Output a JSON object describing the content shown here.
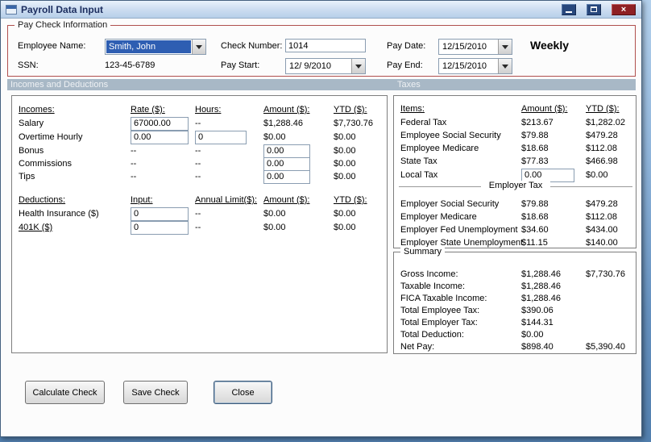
{
  "window": {
    "title": "Payroll Data Input"
  },
  "icons": {
    "close": "×"
  },
  "paycheck": {
    "group_title": "Pay Check Information",
    "labels": {
      "employee": "Employee Name:",
      "ssn": "SSN:",
      "check_number": "Check Number:",
      "pay_start": "Pay Start:",
      "pay_date": "Pay Date:",
      "pay_end": "Pay End:"
    },
    "employee_name": "Smith, John",
    "ssn": "123-45-6789",
    "check_number": "1014",
    "pay_start": "12/ 9/2010",
    "pay_date": "12/15/2010",
    "pay_end": "12/15/2010",
    "frequency": "Weekly"
  },
  "bands": {
    "left": "Incomes and Deductions",
    "right": "Taxes"
  },
  "incomes": {
    "headers": {
      "col1": "Incomes:",
      "col2": "Rate ($):",
      "col3": "Hours:",
      "col4": "Amount ($):",
      "col5": "YTD ($):"
    },
    "salary": {
      "label": "Salary",
      "rate": "67000.00",
      "hours": "--",
      "amount": "$1,288.46",
      "ytd": "$7,730.76"
    },
    "overtime": {
      "label": "Overtime Hourly",
      "rate": "0.00",
      "hours": "0",
      "amount": "$0.00",
      "ytd": "$0.00"
    },
    "bonus": {
      "label": "Bonus",
      "rate": "--",
      "hours": "--",
      "amount": "0.00",
      "ytd": "$0.00"
    },
    "commissions": {
      "label": "Commissions",
      "rate": "--",
      "hours": "--",
      "amount": "0.00",
      "ytd": "$0.00"
    },
    "tips": {
      "label": "Tips",
      "rate": "--",
      "hours": "--",
      "amount": "0.00",
      "ytd": "$0.00"
    }
  },
  "deductions": {
    "headers": {
      "col1": "Deductions:",
      "col2": "Input:",
      "col3": "Annual Limit($):",
      "col4": "Amount ($):",
      "col5": "YTD ($):"
    },
    "health": {
      "label": "Health Insurance  ($)",
      "input": "0",
      "limit": "--",
      "amount": "$0.00",
      "ytd": "$0.00"
    },
    "k401": {
      "label": "401K  ($)",
      "input": "0",
      "limit": "--",
      "amount": "$0.00",
      "ytd": "$0.00"
    }
  },
  "taxes": {
    "headers": {
      "col1": "Items:",
      "col2": "Amount ($):",
      "col3": "YTD ($):"
    },
    "rows": [
      {
        "label": "Federal Tax",
        "amount": "$213.67",
        "ytd": "$1,282.02"
      },
      {
        "label": "Employee Social Security",
        "amount": "$79.88",
        "ytd": "$479.28"
      },
      {
        "label": "Employee Medicare",
        "amount": "$18.68",
        "ytd": "$112.08"
      },
      {
        "label": "State Tax",
        "amount": "$77.83",
        "ytd": "$466.98"
      }
    ],
    "local_tax": {
      "label": "Local Tax",
      "amount": "0.00",
      "ytd": "$0.00"
    },
    "employer_header": "Employer Tax",
    "employer_rows": [
      {
        "label": "Employer Social Security",
        "amount": "$79.88",
        "ytd": "$479.28"
      },
      {
        "label": "Employer Medicare",
        "amount": "$18.68",
        "ytd": "$112.08"
      },
      {
        "label": "Employer Fed Unemployment",
        "amount": "$34.60",
        "ytd": "$434.00"
      },
      {
        "label": "Employer State Unemployment",
        "amount": "$11.15",
        "ytd": "$140.00"
      }
    ]
  },
  "summary": {
    "group_title": "Summary",
    "rows": [
      {
        "label": "Gross Income:",
        "amount": "$1,288.46",
        "ytd": "$7,730.76"
      },
      {
        "label": "Taxable Income:",
        "amount": "$1,288.46",
        "ytd": ""
      },
      {
        "label": "FICA Taxable Income:",
        "amount": "$1,288.46",
        "ytd": ""
      },
      {
        "label": "Total Employee Tax:",
        "amount": "$390.06",
        "ytd": ""
      },
      {
        "label": "Total Employer Tax:",
        "amount": "$144.31",
        "ytd": ""
      },
      {
        "label": "Total Deduction:",
        "amount": "$0.00",
        "ytd": ""
      },
      {
        "label": "Net Pay:",
        "amount": "$898.40",
        "ytd": "$5,390.40"
      }
    ]
  },
  "buttons": {
    "calculate": "Calculate Check",
    "save": "Save Check",
    "close": "Close"
  }
}
